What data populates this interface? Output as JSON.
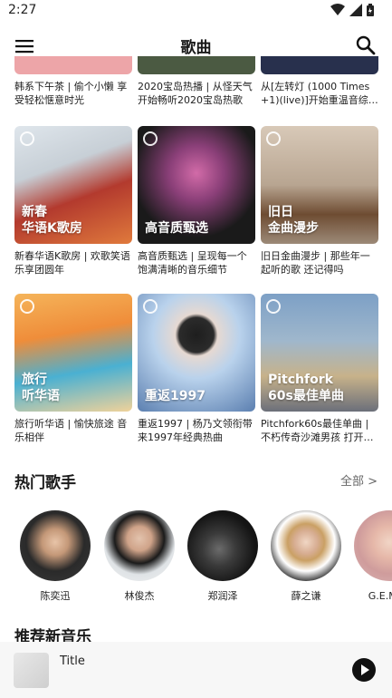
{
  "status_bar": {
    "time": "2:27"
  },
  "header": {
    "title": "歌曲"
  },
  "playlists_top": [
    {
      "caption": "韩系下午茶 | 偷个小懒 享受轻松惬意时光",
      "color": "#eda5a8"
    },
    {
      "caption": "2020宝岛热播 | 从怪天气开始畅听2020宝岛热歌",
      "color": "#4b5a42"
    },
    {
      "caption": "从[左转灯 (1000 Times +1)(live)]开始重温音综…",
      "color": "#28304d"
    }
  ],
  "playlists": [
    {
      "cover_text": "新春\n华语K歌房",
      "caption": "新春华语K歌房 | 欢歌笑语 乐享团圆年",
      "color1": "#c23a33",
      "color2": "#f0d7c0"
    },
    {
      "cover_text": "高音质甄选",
      "caption": "高音质甄选 | 呈现每一个饱满清晰的音乐细节",
      "color1": "#1c1c1c",
      "color2": "#b44e8e"
    },
    {
      "cover_text": "旧日\n金曲漫步",
      "caption": "旧日金曲漫步 | 那些年一起听的歌 还记得吗",
      "color1": "#9c8a78",
      "color2": "#d8c9b8"
    },
    {
      "cover_text": "旅行\n听华语",
      "caption": "旅行听华语 | 愉快旅途 音乐相伴",
      "color1": "#f29a3e",
      "color2": "#3aa0c8"
    },
    {
      "cover_text": "重返1997",
      "caption": "重返1997 | 杨乃文领衔带来1997年经典热曲",
      "color1": "#b9d2ec",
      "color2": "#5b7fb0"
    },
    {
      "cover_text": "Pitchfork\n60s最佳单曲",
      "caption": "Pitchfork60s最佳单曲 | 不朽传奇沙滩男孩 打开…",
      "color1": "#7da0c6",
      "color2": "#c7b28a"
    }
  ],
  "hot_singers": {
    "title": "热门歌手",
    "see_all": "全部 >",
    "items": [
      {
        "name": "陈奕迅",
        "color": "#3a3a3a"
      },
      {
        "name": "林俊杰",
        "color": "#2b2b2b"
      },
      {
        "name": "郑润泽",
        "color": "#1e1e1e"
      },
      {
        "name": "薛之谦",
        "color": "#101010"
      },
      {
        "name": "G.E.M.邓",
        "color": "#d9b4b4"
      }
    ]
  },
  "new_music": {
    "title": "推荐新音乐"
  },
  "mini_player": {
    "title": "Title"
  }
}
